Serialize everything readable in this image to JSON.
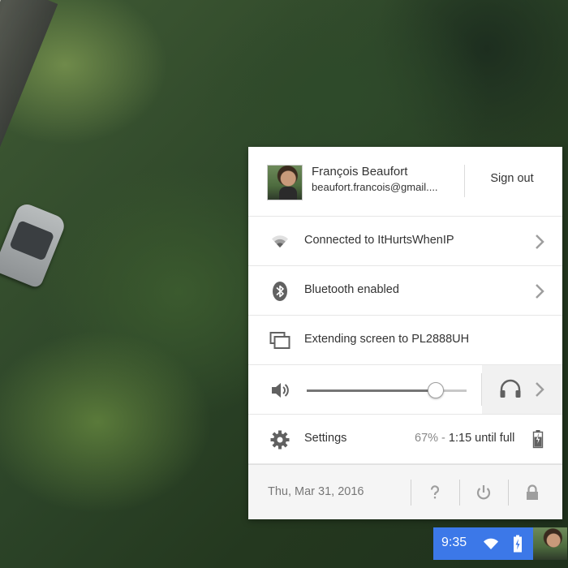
{
  "user": {
    "name": "François Beaufort",
    "email": "beaufort.francois@gmail....",
    "sign_out_label": "Sign out"
  },
  "network": {
    "label": "Connected to ItHurtsWhenIP",
    "icon": "wifi-icon"
  },
  "bluetooth": {
    "label": "Bluetooth enabled",
    "icon": "bluetooth-icon"
  },
  "display": {
    "label": "Extending screen to PL2888UH",
    "icon": "display-icon"
  },
  "volume": {
    "level": 0.8,
    "icon": "speaker-icon",
    "output_icon": "headphones-icon"
  },
  "settings": {
    "label": "Settings",
    "icon": "gear-icon"
  },
  "battery": {
    "percent": "67%",
    "separator": " - ",
    "time_until_full": "1:15 until full",
    "icon": "battery-charging-icon"
  },
  "footer": {
    "date": "Thu, Mar 31, 2016",
    "help_icon": "help-icon",
    "power_icon": "power-icon",
    "lock_icon": "lock-icon"
  },
  "shelf": {
    "clock": "9:35",
    "wifi_icon": "wifi-icon",
    "battery_icon": "battery-charging-icon"
  },
  "colors": {
    "accent": "#3c78e8",
    "icon_gray": "#616161",
    "chevron_gray": "#9e9e9e"
  }
}
